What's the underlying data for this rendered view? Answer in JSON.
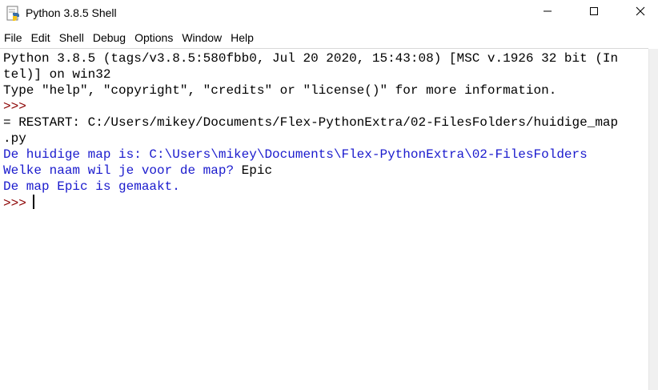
{
  "window": {
    "title": "Python 3.8.5 Shell",
    "icon": "python-idle-icon",
    "controls": {
      "minimize": "minimize-icon",
      "maximize": "maximize-icon",
      "close": "close-icon"
    }
  },
  "menu": {
    "items": [
      "File",
      "Edit",
      "Shell",
      "Debug",
      "Options",
      "Window",
      "Help"
    ]
  },
  "shell": {
    "lines": [
      "Python 3.8.5 (tags/v3.8.5:580fbb0, Jul 20 2020, 15:43:08) [MSC v.1926 32 bit (In",
      "tel)] on win32",
      "Type \"help\", \"copyright\", \"credits\" or \"license()\" for more information.",
      ">>>",
      "= RESTART: C:/Users/mikey/Documents/Flex-PythonExtra/02-FilesFolders/huidige_map",
      ".py",
      "De huidige map is: C:\\Users\\mikey\\Documents\\Flex-PythonExtra\\02-FilesFolders",
      "Welke naam wil je voor de map? ",
      "De map Epic is gemaakt.",
      ">>>"
    ],
    "input_value": "Epic"
  },
  "colors": {
    "prompt": "#8b0000",
    "output": "#1a1acd",
    "text": "#000000"
  }
}
